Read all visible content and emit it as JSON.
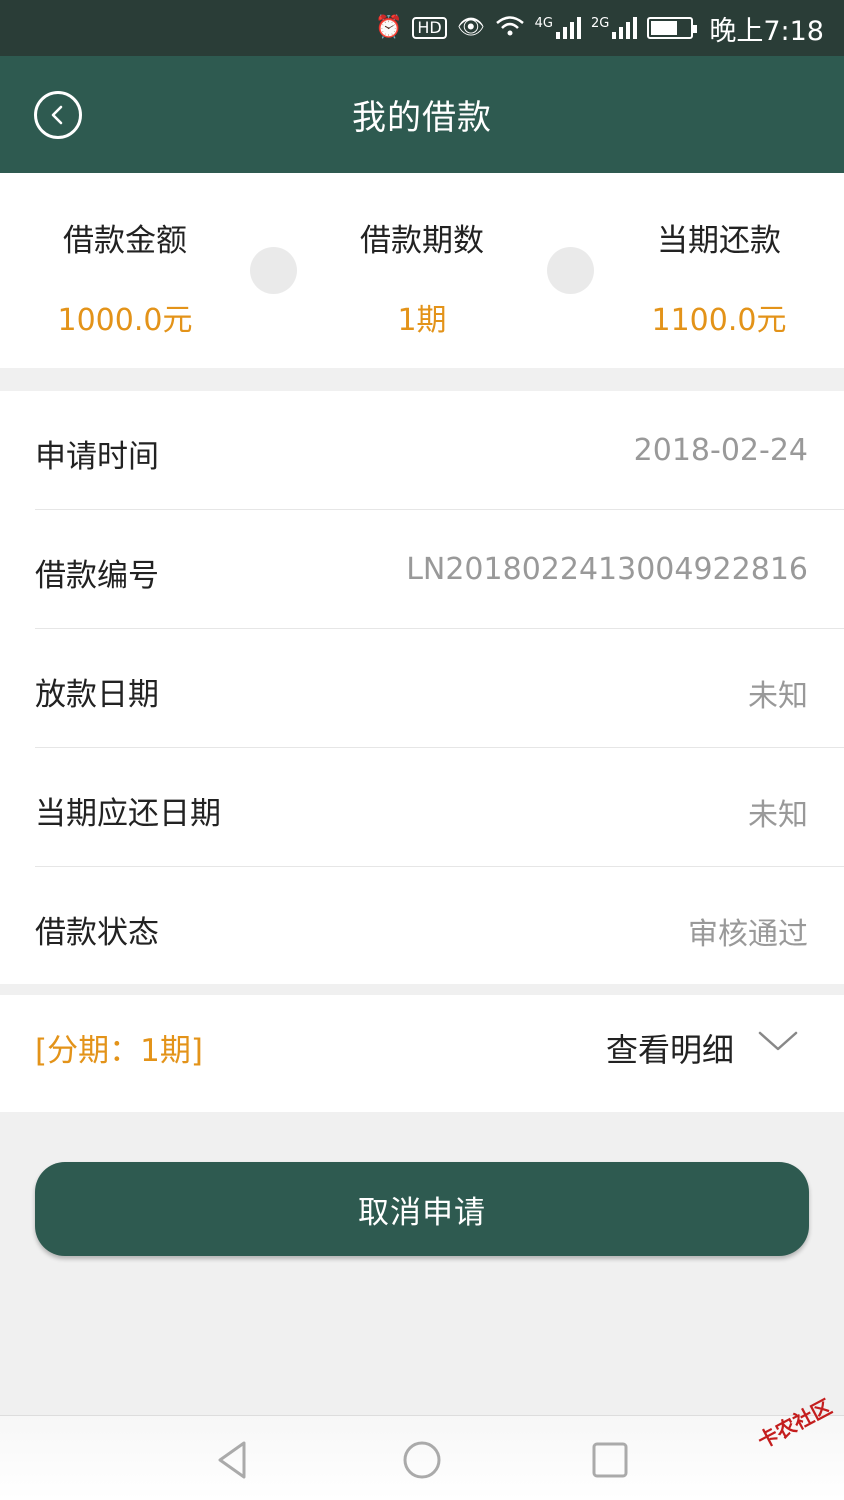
{
  "status_bar": {
    "time": "晚上7:18",
    "net1": "4G",
    "net2": "2G",
    "hd": "HD"
  },
  "nav": {
    "title": "我的借款"
  },
  "summary": [
    {
      "label": "借款金额",
      "value": "1000.0元"
    },
    {
      "label": "借款期数",
      "value": "1期"
    },
    {
      "label": "当期还款",
      "value": "1100.0元"
    }
  ],
  "details": [
    {
      "key": "申请时间",
      "value": "2018-02-24"
    },
    {
      "key": "借款编号",
      "value": "LN20180224130049228​16"
    },
    {
      "key": "放款日期",
      "value": "未知"
    },
    {
      "key": "当期应还日期",
      "value": "未知"
    },
    {
      "key": "借款状态",
      "value": "审核通过"
    }
  ],
  "installment": {
    "label": "[分期：1期]",
    "view_detail": "查看明细"
  },
  "cancel_button": "取消申请",
  "watermark": "卡农社区",
  "colors": {
    "primary": "#2e5a50",
    "status_bar": "#2a3d37",
    "accent": "#e39319",
    "background": "#f0f0f0"
  }
}
